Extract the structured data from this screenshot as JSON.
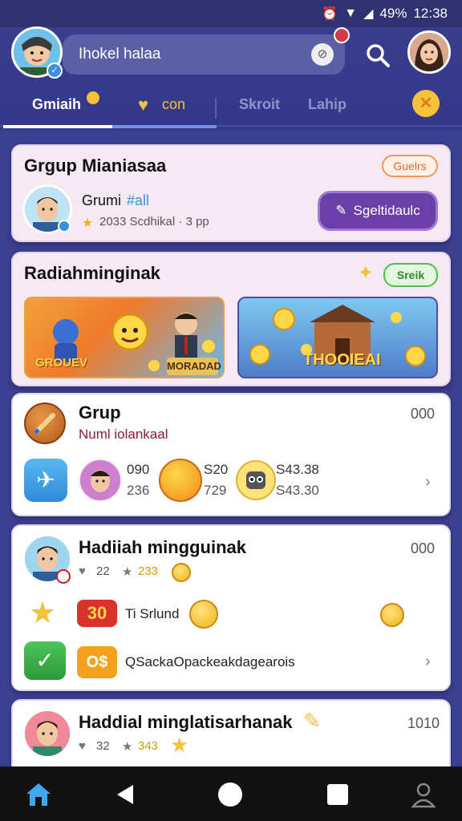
{
  "status": {
    "battery": "49%",
    "time": "12:38"
  },
  "header": {
    "search_text": "Ihokel halaa",
    "notification_count": ""
  },
  "tabs": [
    {
      "label": "Gmiaih"
    },
    {
      "label": "con"
    },
    {
      "label": "Skroit"
    },
    {
      "label": "Lahip"
    }
  ],
  "group_card": {
    "title": "Grgup Mianiasaa",
    "badge": "Guelrs",
    "user_name": "Grumi",
    "user_tag": "#all",
    "meta": "2033  Scdhikal  ·  3 pp",
    "action_button": "Sgeltidaulc"
  },
  "rewards_card": {
    "title": "Radiahminginak",
    "badge": "Sreik",
    "banner_left": "GROUEV",
    "banner_left_right": "MORADAD",
    "banner_right": "THOOIEAI"
  },
  "grup_card": {
    "title": "Grup",
    "subtitle": "Numl iolankaal",
    "count": "000",
    "stats": [
      {
        "top": "090",
        "bottom": "236"
      },
      {
        "top": "S20",
        "bottom": "729"
      },
      {
        "top": "S43.38",
        "bottom": "S43.30"
      }
    ]
  },
  "hadiah_card": {
    "title": "Hadiiah mingguinak",
    "count": "000",
    "likes": "22",
    "stars": "233",
    "reward_label": "Ti Srlund",
    "reward_value": "30",
    "item_label": "QSackaOpackeakdagearois"
  },
  "last_card": {
    "title": "Haddial minglatisarhanak",
    "count": "1010",
    "likes": "32",
    "stars": "343"
  },
  "colors": {
    "accent": "#6b3fa8",
    "header": "#3a3d8c",
    "card_pink": "#f6e9f4"
  }
}
